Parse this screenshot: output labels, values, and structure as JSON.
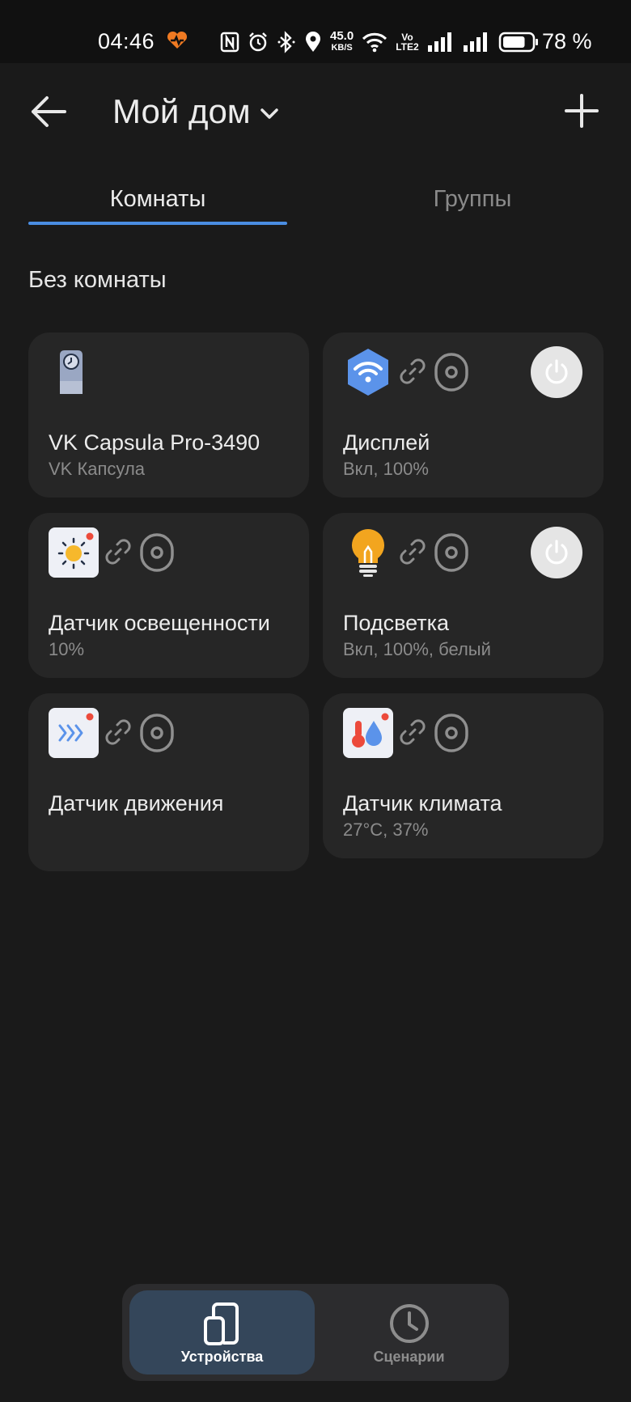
{
  "status_bar": {
    "time": "04:46",
    "network_speed_value": "45.0",
    "network_speed_unit": "KB/S",
    "volte_top": "Vo",
    "volte_bottom": "LTE2",
    "battery_percent": "78 %",
    "battery_level": 0.78
  },
  "header": {
    "home_name": "Мой дом"
  },
  "tabs": [
    {
      "label": "Комнаты",
      "active": true
    },
    {
      "label": "Группы",
      "active": false
    }
  ],
  "section": {
    "title": "Без комнаты"
  },
  "devices": [
    {
      "name": "VK Capsula Pro-3490",
      "status": "VK Капсула",
      "icon": "vk-capsula-speaker-icon",
      "has_power": false
    },
    {
      "name": "Дисплей",
      "status": "Вкл, 100%",
      "icon": "wifi-hexagon-icon",
      "has_power": true
    },
    {
      "name": "Датчик освещенности",
      "status": "10%",
      "icon": "sun-sensor-icon",
      "has_power": false
    },
    {
      "name": "Подсветка",
      "status": "Вкл, 100%, белый",
      "icon": "light-bulb-icon",
      "has_power": true
    },
    {
      "name": "Датчик движения",
      "status": "",
      "icon": "motion-sensor-icon",
      "has_power": false
    },
    {
      "name": "Датчик климата",
      "status": "27°C, 37%",
      "icon": "climate-sensor-icon",
      "has_power": false
    }
  ],
  "bottom_nav": [
    {
      "label": "Устройства",
      "active": true
    },
    {
      "label": "Сценарии",
      "active": false
    }
  ],
  "colors": {
    "accent": "#4a8ee3",
    "background": "#1a1a1a",
    "card": "#262626",
    "bulb": "#f2a51f",
    "sensor_dot": "#ec4a3b"
  }
}
